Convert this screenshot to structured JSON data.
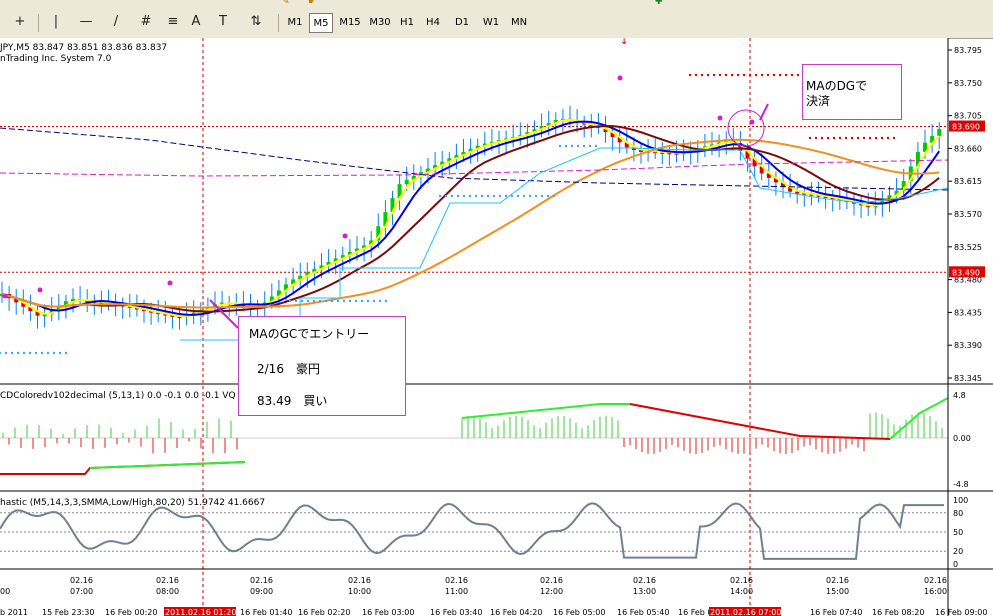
{
  "toolbar": {
    "timeframes": [
      "M1",
      "M5",
      "M15",
      "M30",
      "H1",
      "H4",
      "D1",
      "W1",
      "MN"
    ],
    "active_timeframe": "M5",
    "tool_glyphs": [
      "+",
      "|",
      "—",
      "/",
      "#",
      "A",
      "T",
      "⇅"
    ]
  },
  "chart": {
    "symbol_line": "JPY,M5  83.847 83.851 83.836 83.837",
    "broker_line": "nTrading Inc. System 7.0",
    "price_axis": [
      "83.795",
      "83.750",
      "83.705",
      "83.660",
      "83.615",
      "83.570",
      "83.525",
      "83.480",
      "83.435",
      "83.390",
      "83.345"
    ],
    "price_tag_upper": "83.690",
    "price_tag_lower": "83.490",
    "top_marker": "↓"
  },
  "annotations": {
    "entry": {
      "title": "MAのGCでエントリー",
      "date_line": "2/16　豪円",
      "price_line": "83.49　買い"
    },
    "exit": {
      "line1": "MAのDGで",
      "line2": "決済"
    }
  },
  "macd": {
    "label": "CDColoredv102decimal (5,13,1) 0.0 -0.1 0.0 -0.1 VQ | 7",
    "axis": [
      "4.8",
      "0.00",
      "-4.8"
    ]
  },
  "stochastic": {
    "label": "hastic (M5,14,3,3,SMMA,Low/High,80,20) 51.9742 41.6667",
    "axis": [
      "100",
      "80",
      "50",
      "20",
      "0"
    ]
  },
  "time_axis": {
    "dates": [
      {
        "d": "02.16",
        "t": "07:00"
      },
      {
        "d": "02.16",
        "t": "08:00"
      },
      {
        "d": "02.16",
        "t": "09:00"
      },
      {
        "d": "02.16",
        "t": "10:00"
      },
      {
        "d": "02.16",
        "t": "11:00"
      },
      {
        "d": "02.16",
        "t": "12:00"
      },
      {
        "d": "02.16",
        "t": "13:00"
      },
      {
        "d": "02.16",
        "t": "14:00"
      },
      {
        "d": "02.16",
        "t": "15:00"
      },
      {
        "d": "02.16",
        "t": "16:00"
      }
    ],
    "first_time_fragment": "00",
    "bottom_labels": [
      "b 2011",
      "15 Feb 23:30",
      "16 Feb 00:20",
      "2011.02.16 01:20",
      "16 Feb 01:40",
      "16 Feb 02:20",
      "16 Feb 03:00",
      "16 Feb 03:40",
      "16 Feb 04:20",
      "16 Feb 05:00",
      "16 Feb 05:40",
      "16 Feb 06:",
      "2011.02.16 07:00",
      "16 Feb 07:40",
      "16 Feb 08:20",
      "16 Feb 09:00"
    ],
    "highlight_indices": [
      3,
      12
    ]
  },
  "colors": {
    "bull": "#00cc00",
    "bear": "#dd0000",
    "ma_fast": "#0000dd",
    "ma_mid": "#7a0a0a",
    "ma_slow": "#f09020",
    "grid_v": "#cc0000",
    "magenta": "#d020d0",
    "cyan": "#20c0ff"
  }
}
